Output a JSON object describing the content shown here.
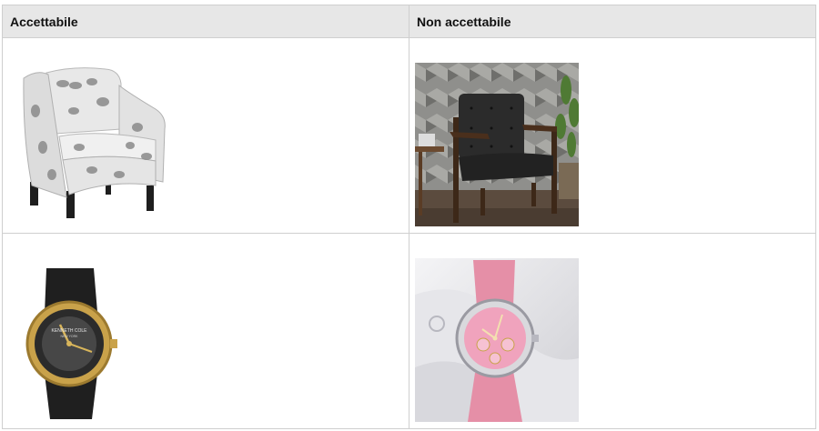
{
  "table": {
    "headers": [
      "Accettabile",
      "Non accettabile"
    ],
    "rows": [
      {
        "acceptable": {
          "icon": "armchair-white-background-image"
        },
        "not_acceptable": {
          "icon": "leather-armchair-lifestyle-image"
        }
      },
      {
        "acceptable": {
          "icon": "gold-watch-white-background-image",
          "brand_text": "KENNETH COLE",
          "brand_sub": "NEW YORK"
        },
        "not_acceptable": {
          "icon": "pink-watch-lifestyle-image"
        }
      }
    ]
  },
  "colors": {
    "header_bg": "#e7e7e7",
    "border": "#cfcfcf",
    "leather_dark": "#2b2b2b",
    "pink_strap": "#e58fa7",
    "gold": "#c9a24a"
  }
}
